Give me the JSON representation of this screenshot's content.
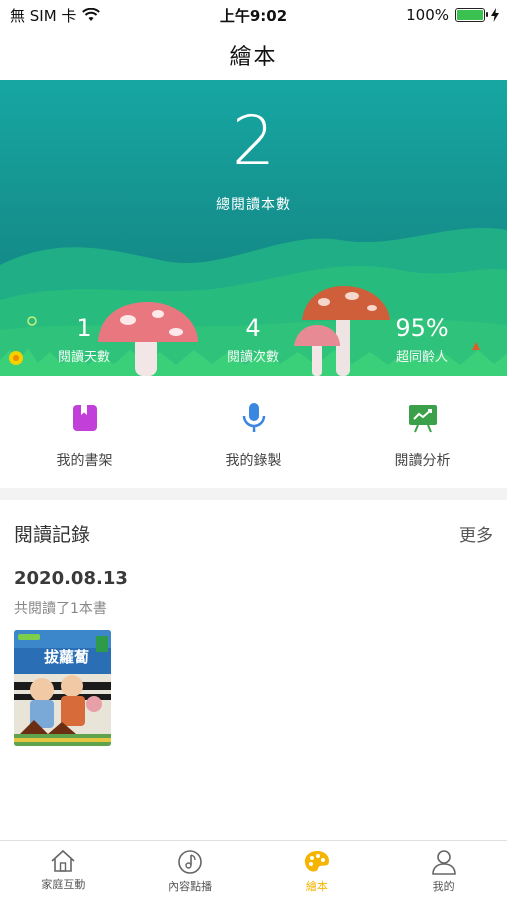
{
  "status_bar": {
    "carrier": "無 SIM 卡",
    "time": "上午9:02",
    "battery": "100%",
    "battery_level": 1.0
  },
  "nav": {
    "title": "繪本"
  },
  "hero": {
    "total_books": "2",
    "total_books_label": "總閱讀本數",
    "stats": [
      {
        "value": "1",
        "label": "閱讀天數"
      },
      {
        "value": "4",
        "label": "閱讀次數"
      },
      {
        "value": "95%",
        "label": "超同齡人"
      }
    ]
  },
  "actions": [
    {
      "label": "我的書架",
      "icon": "bookshelf-icon",
      "color": "#c23fd9"
    },
    {
      "label": "我的錄製",
      "icon": "microphone-icon",
      "color": "#3a86e0"
    },
    {
      "label": "閱讀分析",
      "icon": "chart-board-icon",
      "color": "#3aa14a"
    }
  ],
  "records": {
    "title": "閱讀記錄",
    "more": "更多",
    "date": "2020.08.13",
    "summary": "共閱讀了1本書",
    "book_title": "拔蘿蔔"
  },
  "tabs": [
    {
      "label": "家庭互動",
      "icon": "house-icon",
      "active": false
    },
    {
      "label": "內容點播",
      "icon": "music-disc-icon",
      "active": false
    },
    {
      "label": "繪本",
      "icon": "palette-icon",
      "active": true
    },
    {
      "label": "我的",
      "icon": "person-icon",
      "active": false
    }
  ],
  "colors": {
    "accent": "#f5b400",
    "hero_teal": "#17a7a3",
    "grass": "#2fc27a"
  }
}
